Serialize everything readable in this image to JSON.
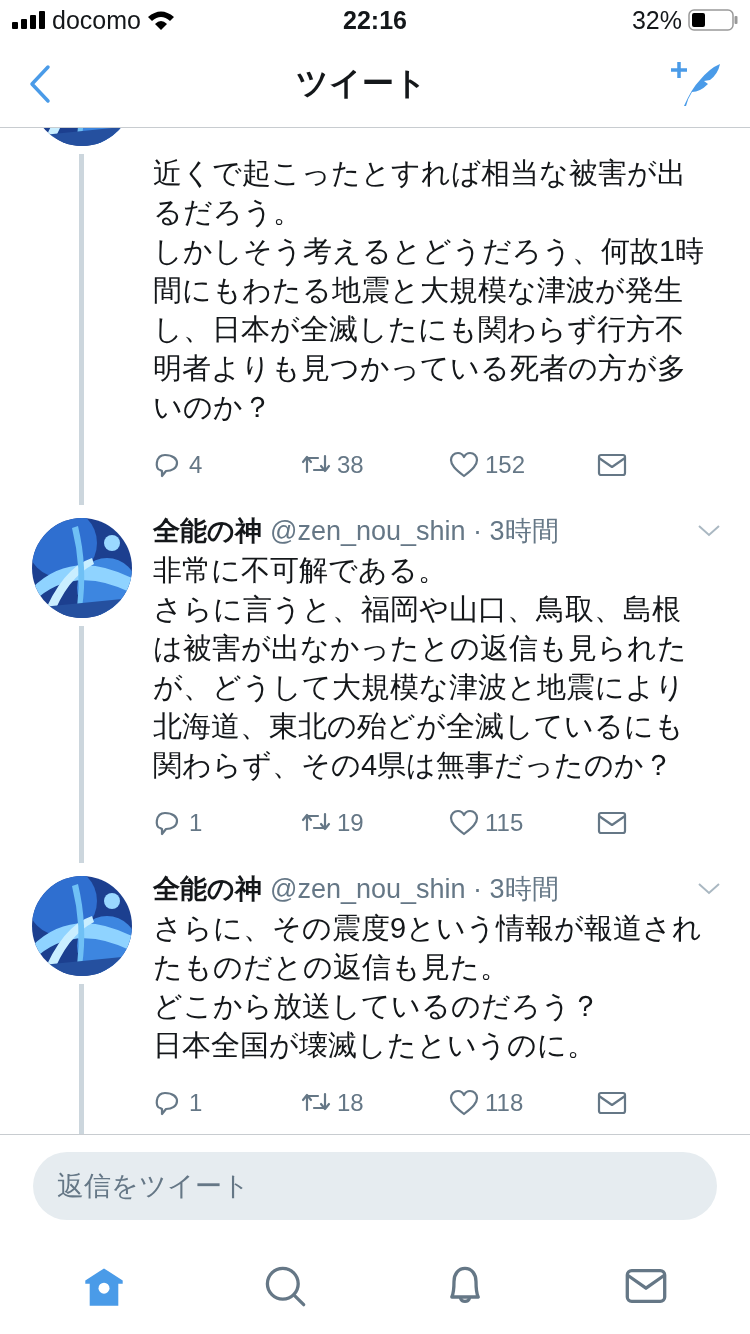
{
  "status_bar": {
    "carrier": "docomo",
    "time": "22:16",
    "battery": "32%"
  },
  "nav": {
    "title": "ツイート"
  },
  "tweets": [
    {
      "kind": "continued",
      "lines": [
        "近くで起こったとすれば相当な被害が出",
        "るだろう。",
        "しかしそう考えるとどうだろう、何故1時",
        "間にもわたる地震と大規模な津波が発生",
        "し、日本が全滅したにも関わらず行方不",
        "明者よりも見つかっている死者の方が多",
        "いのか？"
      ],
      "replies": "4",
      "retweets": "38",
      "likes": "152"
    },
    {
      "kind": "full",
      "name": "全能の神",
      "meta": "@zen_nou_shin · 3時間",
      "lines": [
        "非常に不可解である。",
        "さらに言うと、福岡や山口、鳥取、島根",
        "は被害が出なかったとの返信も見られた",
        "が、どうして大規模な津波と地震により",
        "北海道、東北の殆どが全滅しているにも",
        "関わらず、その4県は無事だったのか？"
      ],
      "replies": "1",
      "retweets": "19",
      "likes": "115"
    },
    {
      "kind": "full",
      "name": "全能の神",
      "meta": "@zen_nou_shin · 3時間",
      "lines": [
        "さらに、その震度9という情報が報道され",
        "たものだとの返信も見た。",
        "どこから放送しているのだろう？",
        "日本全国が壊滅したというのに。"
      ],
      "replies": "1",
      "retweets": "18",
      "likes": "118"
    }
  ],
  "reply_field": {
    "placeholder": "返信をツイート"
  },
  "tabs": [
    {
      "kind": "home",
      "selected": true
    },
    {
      "kind": "search",
      "selected": false
    },
    {
      "kind": "notifications",
      "selected": false
    },
    {
      "kind": "messages",
      "selected": false
    }
  ]
}
